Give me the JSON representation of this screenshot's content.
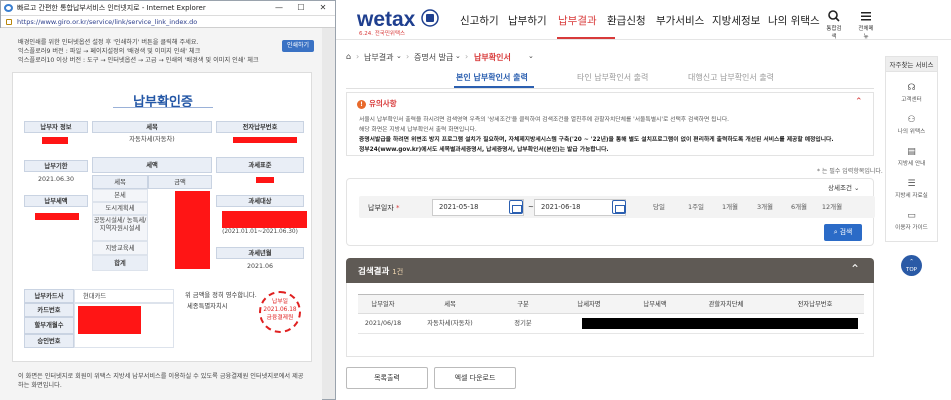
{
  "popup": {
    "window_title": "빠르고 간편한 통합납부서비스 인터넷지로 - Internet Explorer",
    "url": "https://www.giro.or.kr/service/link/service_link_index.do",
    "notice_lines": [
      "배경인쇄를 위한 인터넷옵션 설정 후 '인쇄하기' 버튼을 클릭해 주세요.",
      "익스플로러9 버전 : 파일 → 페이지설정의 '배경색 및 이미지 인쇄' 체크",
      "익스플로러10 이상 버전 : 도구 → 인터넷옵션 → 고급 → 인쇄의 '배경색 및 이미지 인쇄' 체크"
    ],
    "print_button": "인쇄하기",
    "certificate": {
      "title": "납부확인증",
      "payer_info_label": "납부자 정보",
      "tax_item_label": "세목",
      "tax_item_value": "자동차세(자동차)",
      "e_pay_no_label": "전자납부번호",
      "due_date_label": "납부기한",
      "due_date_value": "2021.06.30",
      "tax_amount_label": "세액",
      "tax_base_label": "과세표준",
      "pay_amount_label": "납부세액",
      "col_tax_item": "세목",
      "col_amount": "금액",
      "rows": [
        "본세",
        "도시계획세",
        "공동시설세/ 농특세/ 지역자원시설세",
        "지방교육세",
        "합계"
      ],
      "tax_target_label": "과세대상",
      "tax_target_period": "(2021.01.01~2021.06.30)",
      "tax_year_month_label": "과세년월",
      "tax_year_month_value": "2021.06",
      "card_company_label": "납부카드사",
      "card_company_value": "현대카드",
      "card_no_label": "카드번호",
      "installment_label": "할부개월수",
      "approval_no_label": "승인번호",
      "received_text": "위 금액을 정히 영수합니다.",
      "received_by": "세종특별자치시",
      "stamp_lines": [
        "납부일",
        "2021.06.18",
        "금융결제원"
      ]
    },
    "footnote": "이 화면은 인터넷지로 회원이 위택스 지방세 납부서비스를 이용하실 수 있도록 금융결제원 인터넷지로에서 제공하는 화면입니다."
  },
  "site": {
    "logo_text": "wetax",
    "logo_sub": "6.24. 전국민위택스",
    "nav": [
      "신고하기",
      "납부하기",
      "납부결과",
      "환급신청",
      "부가서비스",
      "지방세정보",
      "나의 위택스"
    ],
    "active_nav": "납부결과",
    "search_icon_label": "통합검색",
    "menu_icon_label": "전체메뉴",
    "breadcrumb": [
      "납부결과",
      "증명서 발급",
      "납부확인서"
    ],
    "tabs": [
      "본인 납부확인서 출력",
      "타인 납부확인서 출력",
      "대행신고 납부확인서 출력"
    ],
    "notice_title": "유의사항",
    "notice_lines": [
      "서울시 납부확인서 출력을 하시려면 검색영역 우측의 '상세조건'을 클릭하여 검색조건을 열친후에 관할자치단체를 '서울특별시'로 선택후 검색하면 됩니다.",
      "해당 화면은 지방세 납부확인서 출력 화면입니다.",
      "증명서발급을 하려면 위변조 방지 프로그램 설치가 필요하며, 자체제지방세시스템 구축('20 ~ '22년)을 통해 별도 설치프로그램이 없이 편리하게 출력하도록 개선된 서비스를 제공할 예정입니다.",
      "정부24(www.gov.kr)에서도 세목별과세증명서, 납세증명서, 납부확인서(본인)는 발급 가능합니다."
    ],
    "required_note": "* 는 필수 입력항목입니다.",
    "detail_condition": "상세조건",
    "date_label": "납부일자",
    "date_from": "2021-05-18",
    "date_to": "2021-06-18",
    "period_buttons": [
      "당일",
      "1주일",
      "1개월",
      "3개월",
      "6개월",
      "12개월"
    ],
    "search_button": "검색",
    "result_title": "검색결과",
    "result_count": "1건",
    "result_columns": [
      "납부일자",
      "세목",
      "구분",
      "납세자명",
      "납부세액",
      "관할자치단체",
      "전자납부번호"
    ],
    "result_rows": [
      [
        "2021/06/18",
        "자동차세(자동차)",
        "정기분",
        "",
        "",
        "",
        ""
      ]
    ],
    "bottom_buttons": [
      "목록출력",
      "엑셀 다운로드"
    ],
    "quick_title": "자주찾는 서비스",
    "quick_items": [
      "고객센터",
      "나의 위택스",
      "지방세 안내",
      "지방세 자료실",
      "이용자 가이드"
    ],
    "top_button": "TOP"
  }
}
